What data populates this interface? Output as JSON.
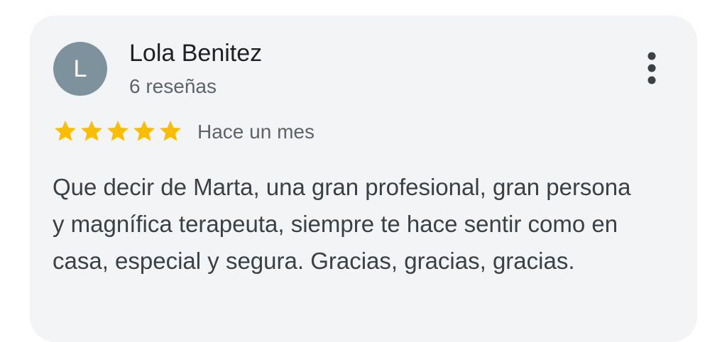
{
  "review": {
    "avatar_letter": "L",
    "avatar_color": "#7e929e",
    "author_name": "Lola Benitez",
    "review_count": "6 reseñas",
    "rating": 5,
    "rating_max": 5,
    "star_color": "#fbbc04",
    "date": "Hace un mes",
    "text": "Que decir de Marta, una gran profesional, gran persona y magnífica terapeuta, siempre te hace sentir como en casa, especial y segura. Gracias, gracias, gracias.",
    "more_icon": "more-vertical-icon"
  }
}
